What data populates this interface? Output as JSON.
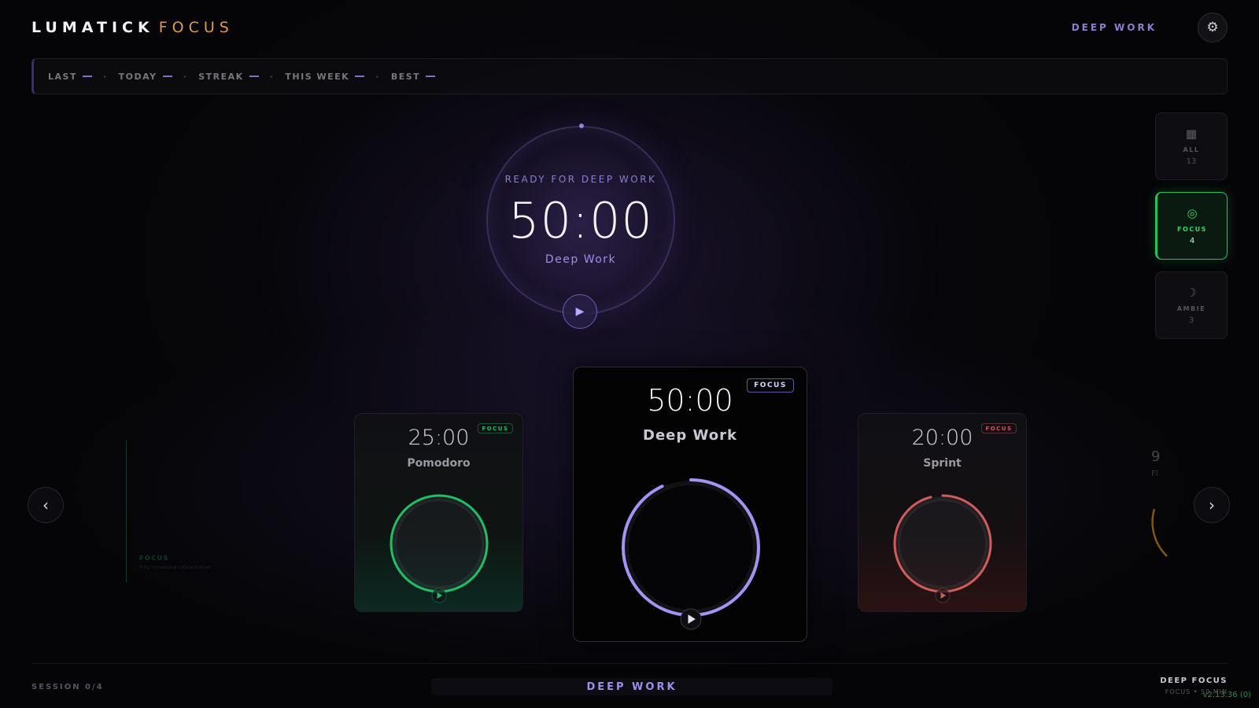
{
  "brand": {
    "name": "LUMATICK",
    "sub": "FOCUS"
  },
  "header": {
    "mode": "DEEP WORK",
    "settings_icon": "gear-icon"
  },
  "stats": [
    {
      "label": "LAST",
      "value": "—"
    },
    {
      "label": "TODAY",
      "value": "—"
    },
    {
      "label": "STREAK",
      "value": "—"
    },
    {
      "label": "THIS WEEK",
      "value": "—"
    },
    {
      "label": "BEST",
      "value": "—"
    }
  ],
  "stats_separator": "·",
  "hero": {
    "status": "READY FOR DEEP WORK",
    "time": "50:00",
    "name": "Deep Work",
    "play_icon": "▶"
  },
  "filters": [
    {
      "icon": "▦",
      "icon_name": "grid-icon",
      "label": "ALL",
      "count": "13",
      "active": false
    },
    {
      "icon": "◎",
      "icon_name": "target-icon",
      "label": "FOCUS",
      "count": "4",
      "active": true
    },
    {
      "icon": "☽",
      "icon_name": "moon-icon",
      "label": "AMBIE",
      "count": "3",
      "active": false
    }
  ],
  "carousel": {
    "prev": "‹",
    "next": "›",
    "cards": [
      {
        "time": "25:00",
        "name": "Pomodoro",
        "tag": "FOCUS",
        "color": "#1fbf66",
        "progress": 1.0
      },
      {
        "time": "50:00",
        "name": "Deep Work",
        "tag": "FOCUS",
        "color": "#a493f3",
        "progress": 0.93
      },
      {
        "time": "20:00",
        "name": "Sprint",
        "tag": "FOCUS",
        "color": "#d05c5c",
        "progress": 0.96
      }
    ],
    "ghost_left": {
      "label": "FOCUS",
      "desc": "Fully immersive concentration"
    },
    "ghost_right": {
      "time": "9",
      "name": "Fl"
    }
  },
  "footer": {
    "session": "SESSION 0/4",
    "center": "DEEP WORK",
    "right_title": "DEEP FOCUS",
    "right_sub": "FOCUS • 50 MIN",
    "version": "v2.13.36 (0)"
  },
  "colors": {
    "accent": "#8a7fd0",
    "brand_sub": "#e09a45",
    "active_filter": "#23c45f"
  }
}
